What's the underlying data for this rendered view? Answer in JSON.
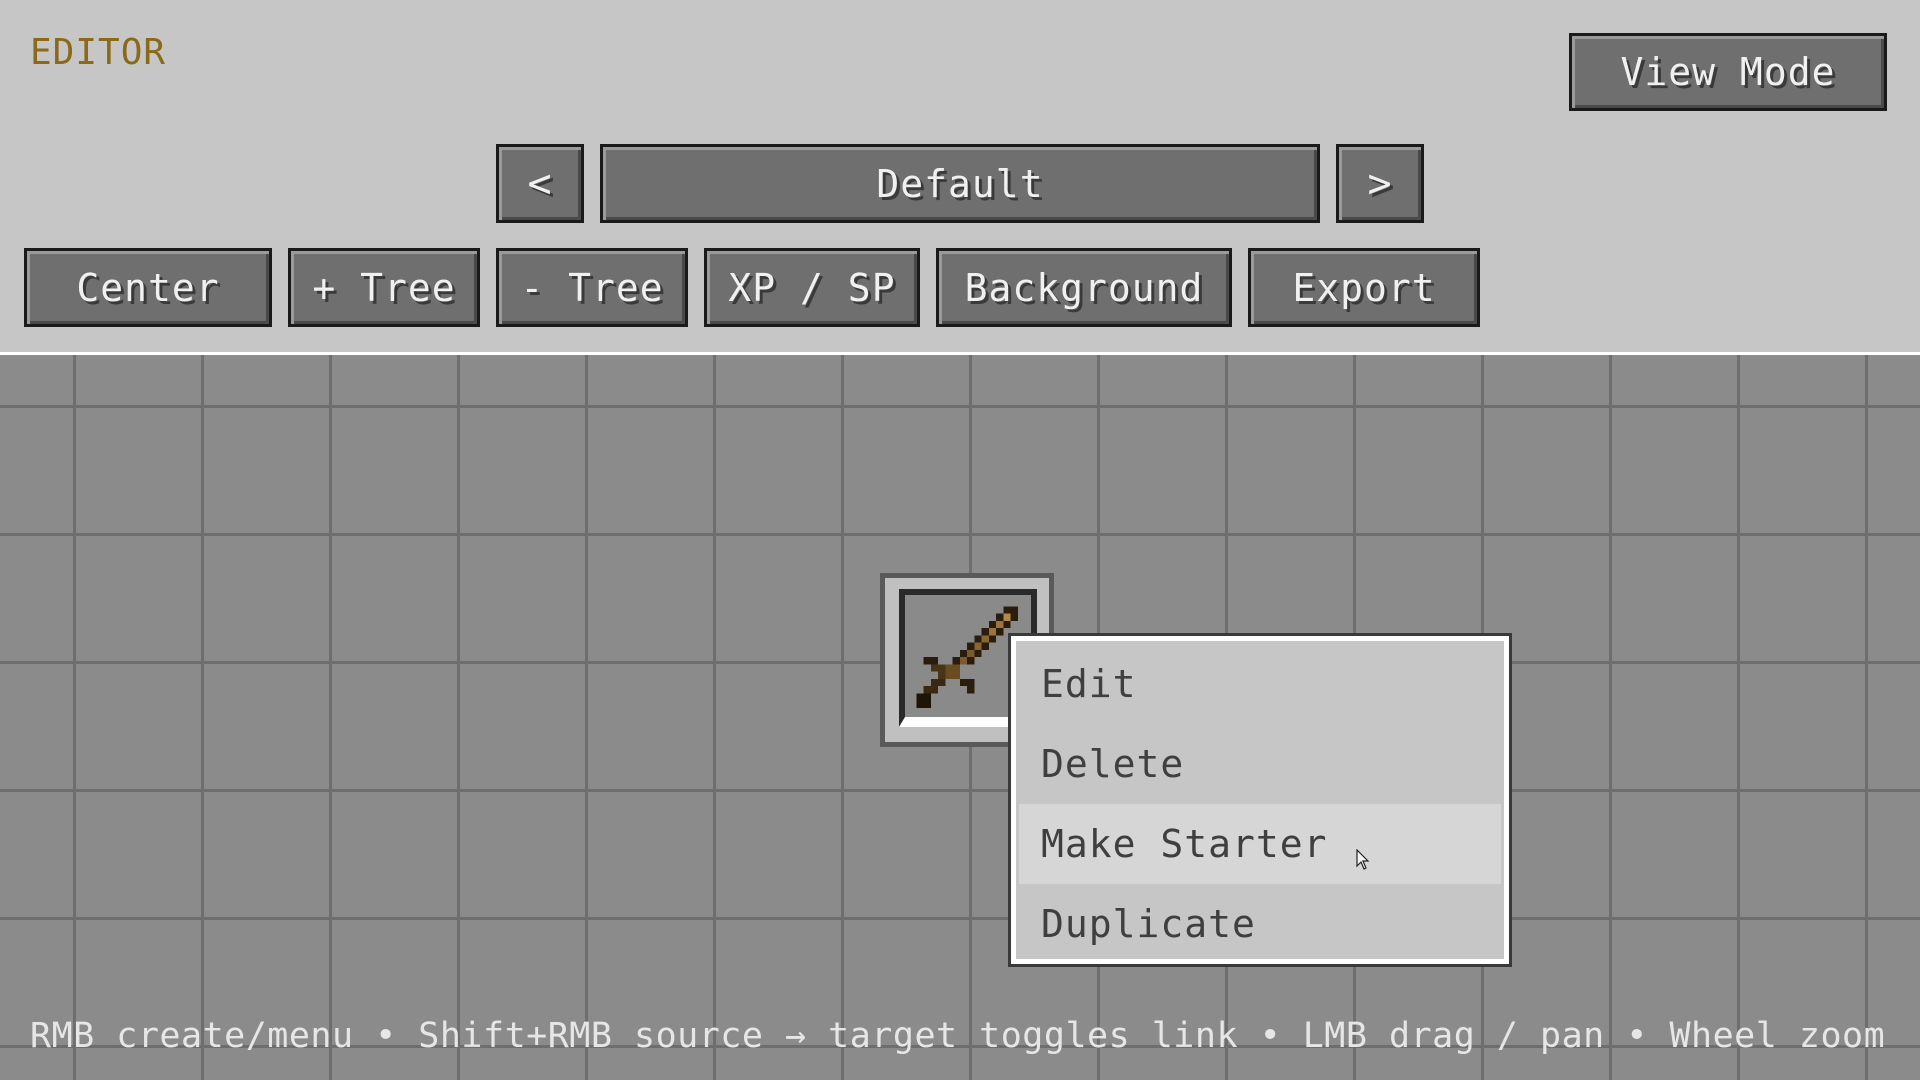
{
  "header": {
    "title": "EDITOR",
    "view_mode_label": "View Mode"
  },
  "tree_selector": {
    "prev_label": "<",
    "current": "Default",
    "next_label": ">"
  },
  "toolbar": {
    "buttons": [
      "Center",
      "+ Tree",
      "- Tree",
      "XP / SP",
      "Background",
      "Export"
    ]
  },
  "node": {
    "icon": "wooden-sword-icon"
  },
  "context_menu": {
    "items": [
      "Edit",
      "Delete",
      "Make Starter",
      "Duplicate"
    ],
    "hovered": "Make Starter"
  },
  "footer": {
    "help": "RMB create/menu • Shift+RMB source → target toggles link • LMB drag / pan • Wheel zoom"
  },
  "colors": {
    "background": "#c6c6c6",
    "canvas": "#8b8b8b",
    "grid_line": "#6e6e6e",
    "title_accent": "#8a6a1a",
    "button": "#6f6f6f",
    "menu": "#c6c6c6"
  }
}
